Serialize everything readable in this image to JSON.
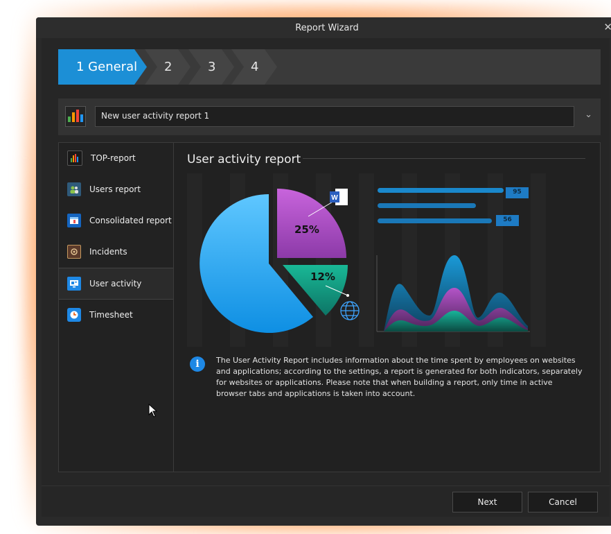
{
  "window": {
    "title": "Report Wizard",
    "close_glyph": "✕"
  },
  "steps": [
    {
      "label": "1 General",
      "active": true
    },
    {
      "label": "2",
      "active": false
    },
    {
      "label": "3",
      "active": false
    },
    {
      "label": "4",
      "active": false
    }
  ],
  "report_name": {
    "value": "New user activity report 1",
    "icon": "bar-chart-icon"
  },
  "sidebar": {
    "items": [
      {
        "label": "TOP-report",
        "icon": "bar-chart-icon"
      },
      {
        "label": "Users report",
        "icon": "users-icon"
      },
      {
        "label": "Consolidated report",
        "icon": "table-icon"
      },
      {
        "label": "Incidents",
        "icon": "gear-shield-icon"
      },
      {
        "label": "User activity",
        "icon": "monitor-icon",
        "active": true
      },
      {
        "label": "Timesheet",
        "icon": "clock-icon"
      }
    ]
  },
  "main": {
    "title": "User activity report",
    "pie_labels": {
      "apps": "25%",
      "web": "12%"
    },
    "bar_badges": [
      "95",
      "56"
    ],
    "info_text": "The User Activity Report includes information about the time spent by employees on websites and applications; according to the settings, a report is generated for both indicators, separately for websites or applications. Please note that when building a report, only time in active browser tabs and applications is taken into account."
  },
  "footer": {
    "next_label": "Next",
    "cancel_label": "Cancel"
  },
  "colors": {
    "accent": "#1c8fd6",
    "pie_blue": "#33b5f5",
    "pie_purple": "#b04fc8",
    "pie_teal": "#149e87"
  }
}
